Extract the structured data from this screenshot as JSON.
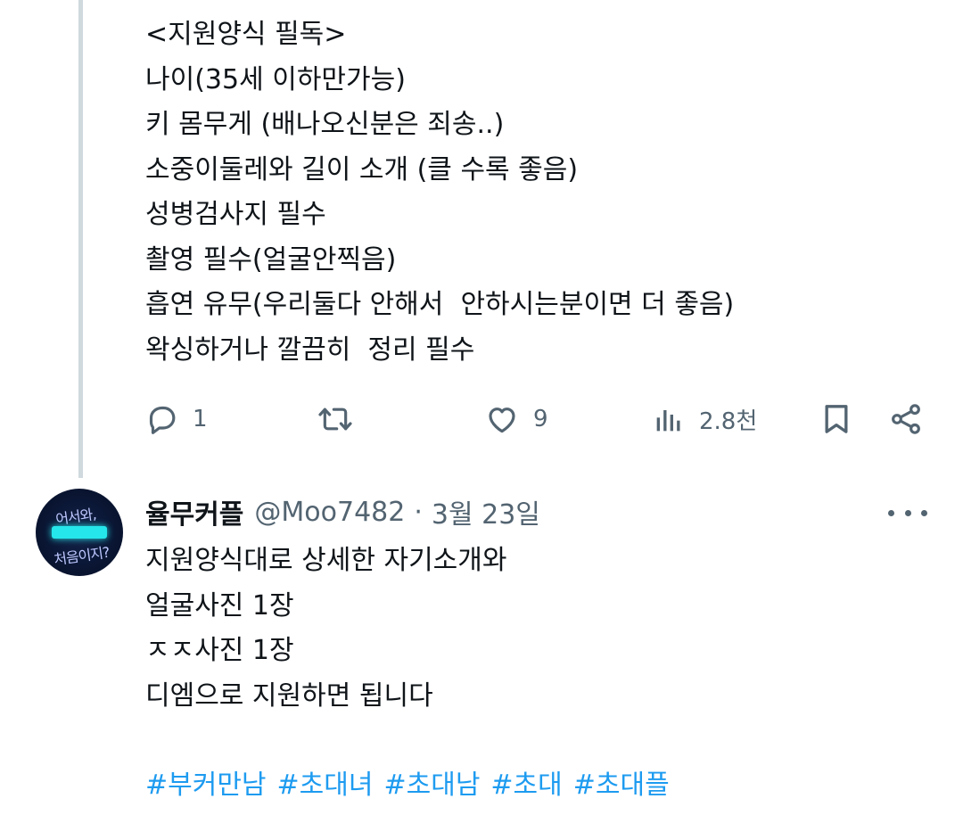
{
  "tweet1": {
    "lines": [
      "<지원양식 필독>",
      "나이(35세 이하만가능)",
      "키 몸무게 (배나오신분은 죄송..)",
      "소중이둘레와 길이 소개 (클 수록 좋음)",
      "성병검사지 필수",
      "촬영 필수(얼굴안찍음)",
      "흡연 유무(우리둘다 안해서  안하시는분이면 더 좋음)",
      "왁싱하거나 깔끔히  정리 필수"
    ],
    "actions": {
      "reply_count": "1",
      "retweet_count": "",
      "like_count": "9",
      "views_count": "2.8천"
    }
  },
  "tweet2": {
    "avatar": {
      "text_top": "어서와,",
      "text_bottom": "처음이지?",
      "accent_color": "#25e6ea"
    },
    "display_name": "율무커플",
    "handle": "@Moo7482",
    "separator": "·",
    "date": "3월 23일",
    "lines": [
      "지원양식대로 상세한 자기소개와",
      "얼굴사진 1장",
      "ㅈㅈ사진 1장",
      "디엠으로 지원하면 됩니다"
    ],
    "hashtags": [
      "#부커만남",
      "#초대녀",
      "#초대남",
      "#초대",
      "#초대플"
    ]
  },
  "colors": {
    "text": "#0f1419",
    "secondary": "#536471",
    "link": "#1d9bf0",
    "thread_line": "#cfd9de"
  },
  "icons": [
    "reply-icon",
    "retweet-icon",
    "like-icon",
    "views-icon",
    "bookmark-icon",
    "share-icon",
    "more-icon"
  ]
}
